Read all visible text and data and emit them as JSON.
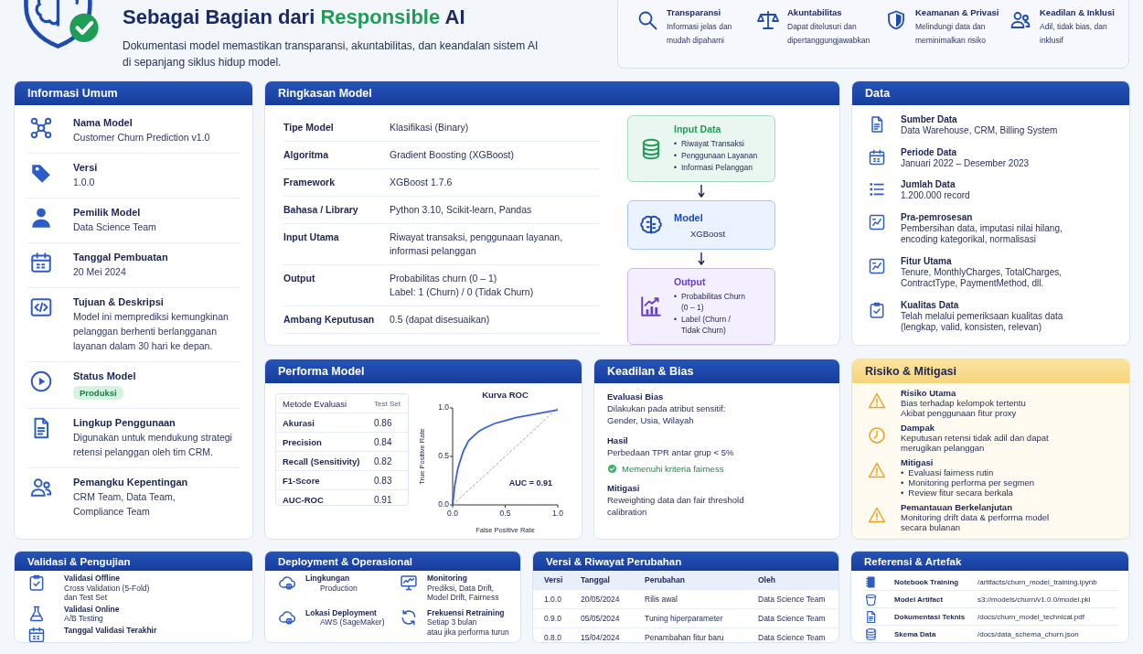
{
  "header": {
    "title": [
      {
        "text": "Sebagai Bagian dari ",
        "accent": false
      },
      {
        "text": "Responsible",
        "accent": true
      },
      {
        "text": " AI",
        "accent": false
      }
    ],
    "description": "Dokumentasi model memastikan transparansi, akuntabilitas, dan keandalan sistem AI\ndi sepanjang siklus hidup model.",
    "principles": [
      {
        "title": "Transparansi",
        "text": "Informasi jelas dan\nmudah dipahami"
      },
      {
        "title": "Akuntabilitas",
        "text": "Dapat ditelusuri dan\ndipertanggungjawabkan"
      },
      {
        "title": "Keamanan & Privasi",
        "text": "Melindungi data dan\nmeminimalkan risiko"
      },
      {
        "title": "Keadilan & Inklusi",
        "text": "Adil, tidak bias, dan\ninklusif"
      }
    ]
  },
  "general_info": {
    "title": "Informasi Umum",
    "items": [
      {
        "kind": "text",
        "label": "Nama Model",
        "value": "Customer Churn Prediction v1.0"
      },
      {
        "kind": "text",
        "label": "Versi",
        "value": "1.0.0"
      },
      {
        "kind": "text",
        "label": "Pemilik Model",
        "value": "Data Science Team"
      },
      {
        "kind": "text",
        "label": "Tanggal Pembuatan",
        "value": "20 Mei 2024"
      },
      {
        "kind": "text",
        "label": "Tujuan & Deskripsi",
        "value": "Model ini memprediksi kemungkinan\npelanggan berhenti berlangganan\nlayanan dalam 30 hari ke depan."
      },
      {
        "kind": "badge",
        "label": "Status Model",
        "value": "Produksi"
      },
      {
        "kind": "text",
        "label": "Lingkup Penggunaan",
        "value": "Digunakan untuk mendukung strategi\nretensi pelanggan oleh tim CRM."
      },
      {
        "kind": "text",
        "label": "Pemangku Kepentingan",
        "value": "CRM Team, Data Team,\nCompliance Team"
      }
    ]
  },
  "summary": {
    "title": "Ringkasan Model",
    "rows": [
      {
        "label": "Tipe Model",
        "value": "Klasifikasi (Binary)"
      },
      {
        "label": "Algoritma",
        "value": "Gradient Boosting (XGBoost)"
      },
      {
        "label": "Framework",
        "value": "XGBoost 1.7.6"
      },
      {
        "label": "Bahasa / Library",
        "value": "Python 3.10, Scikit-learn, Pandas"
      },
      {
        "label": "Input Utama",
        "value": "Riwayat transaksi, penggunaan layanan,\ninformasi pelanggan"
      },
      {
        "label": "Output",
        "value": "Probabilitas churn (0 – 1)\nLabel: 1 (Churn) / 0 (Tidak Churn)"
      },
      {
        "label": "Ambang Keputusan",
        "value": "0.5 (dapat disesuaikan)"
      }
    ],
    "flow": [
      {
        "kind": "input",
        "title": "Input Data",
        "marker": "•",
        "items": [
          "Riwayat Transaksi",
          "Penggunaan Layanan",
          "Informasi Pelanggan"
        ]
      },
      {
        "kind": "model",
        "title": "Model",
        "subtitle": "XGBoost"
      },
      {
        "kind": "output",
        "title": "Output",
        "marker": "•",
        "items": [
          "Probabilitas Churn\n(0 – 1)",
          "Label (Churn /\nTidak Churn)"
        ]
      }
    ]
  },
  "data": {
    "title": "Data",
    "items": [
      {
        "label": "Sumber Data",
        "value": "Data Warehouse, CRM, Billing System"
      },
      {
        "label": "Periode Data",
        "value": "Januari 2022 – Desember 2023"
      },
      {
        "label": "Jumlah Data",
        "value": "1.200.000 record"
      },
      {
        "label": "Pra-pemrosesan",
        "value": "Pembersihan data, imputasi nilai hilang,\nencoding kategorikal, normalisasi"
      },
      {
        "label": "Fitur Utama",
        "value": "Tenure, MonthlyCharges, TotalCharges,\nContractType, PaymentMethod, dll."
      },
      {
        "label": "Kualitas Data",
        "value": "Telah melalui pemeriksaan kualitas data\n(lengkap, valid, konsisten, relevan)"
      }
    ]
  },
  "performance": {
    "title": "Performa Model",
    "table": {
      "columns": [
        "Metode Evaluasi",
        "Test Set"
      ],
      "rows": [
        [
          "Akurasi",
          "0.86"
        ],
        [
          "Precision",
          "0.84"
        ],
        [
          "Recall (Sensitivity)",
          "0.82"
        ],
        [
          "F1-Score",
          "0.83"
        ],
        [
          "AUC-ROC",
          "0.91"
        ]
      ]
    },
    "chart_data": {
      "type": "line",
      "title": "Kurva ROC",
      "xlabel": "False Positive Rate",
      "ylabel": "True Positive Rate",
      "x": [
        0,
        0.02,
        0.05,
        0.1,
        0.15,
        0.2,
        0.25,
        0.3,
        0.4,
        0.5,
        0.6,
        0.8,
        1
      ],
      "series": [
        {
          "color": "#3a62d8",
          "values": [
            0,
            0.2,
            0.38,
            0.55,
            0.66,
            0.71,
            0.76,
            0.79,
            0.84,
            0.87,
            0.9,
            0.94,
            0.98
          ]
        },
        {
          "color": "#9aa3b5",
          "line_style": "dashed",
          "values": [
            0,
            0.02,
            0.05,
            0.1,
            0.15,
            0.2,
            0.25,
            0.3,
            0.4,
            0.5,
            0.6,
            0.8,
            1
          ]
        }
      ],
      "xlim": [
        0,
        1
      ],
      "ylim": [
        0,
        1
      ],
      "xticks": [
        {
          "value": 0,
          "label": "0.0"
        },
        {
          "value": 0.5,
          "label": "0.5"
        },
        {
          "value": 1,
          "label": "1.0"
        }
      ],
      "yticks": [
        {
          "value": 0,
          "label": "0.0"
        },
        {
          "value": 0.5,
          "label": "0.5"
        },
        {
          "value": 1,
          "label": "1.0"
        }
      ],
      "annotations": [
        "AUC = 0.91"
      ]
    }
  },
  "fairness": {
    "title": "Keadilan & Bias",
    "sections": [
      {
        "title": "Evaluasi Bias",
        "text": "Dilakukan pada atribut sensitif:\nGender, Usia, Wilayah"
      },
      {
        "title": "Hasil",
        "text": "Perbedaan TPR antar grup < 5%",
        "check": {
          "text": "Memenuhi kriteria fairness",
          "met": true
        }
      },
      {
        "title": "Mitigasi",
        "text": "Reweighting data dan fair threshold\ncalibration"
      }
    ]
  },
  "risks": {
    "title": "Risiko & Mitigasi",
    "items": [
      {
        "title": "Risiko Utama",
        "text": "Bias terhadap kelompok tertentu\nAkibat penggunaan fitur proxy"
      },
      {
        "title": "Dampak",
        "text": "Keputusan retensi tidak adil dan dapat\nmerugikan pelanggan"
      },
      {
        "title": "Mitigasi",
        "marker": "•",
        "bullets": [
          "Evaluasi fairness rutin",
          "Monitoring performa per segmen",
          "Review fitur secara berkala"
        ]
      },
      {
        "title": "Pemantauan Berkelanjutan",
        "text": "Monitoring drift data & performa model\nsecara bulanan"
      }
    ]
  },
  "validation": {
    "title": "Validasi & Pengujian",
    "items": [
      {
        "title": "Validasi Offline",
        "text": "Cross Validation (5-Fold)\ndan Test Set"
      },
      {
        "title": "Validasi Online",
        "text": "A/B Testing"
      },
      {
        "title": "Tanggal Validasi Terakhir"
      }
    ]
  },
  "deployment": {
    "title": "Deployment & Operasional",
    "items": [
      {
        "title": "Lingkungan",
        "text": "Production"
      },
      {
        "title": "Monitoring",
        "text": "Prediksi, Data Drift,\nModel Drift, Fairness"
      },
      {
        "title": "Lokasi Deployment",
        "text": "AWS (SageMaker)"
      },
      {
        "title": "Frekuensi Retraining",
        "text": "Setiap 3 bulan\natau jika performa turun"
      }
    ]
  },
  "versions": {
    "title": "Versi & Riwayat Perubahan",
    "columns": [
      "Versi",
      "Tanggal",
      "Perubahan",
      "Oleh"
    ],
    "rows": [
      [
        "1.0.0",
        "20/05/2024",
        "Rilis awal",
        "Data Science Team"
      ],
      [
        "0.9.0",
        "05/05/2024",
        "Tuning hiperparameter",
        "Data Science Team"
      ],
      [
        "0.8.0",
        "15/04/2024",
        "Penambahan fitur baru",
        "Data Science Team"
      ]
    ]
  },
  "references": {
    "title": "Referensi & Artefak",
    "items": [
      {
        "name": "Notebook Training",
        "path": "/artifacts/churn_model_training.ipynb"
      },
      {
        "name": "Model Artifact",
        "path": "s3://models/churn/v1.0.0/model.pkl"
      },
      {
        "name": "Dokumentasi Teknis",
        "path": "/docs/churn_model_technical.pdf"
      },
      {
        "name": "Skema Data",
        "path": "/docs/data_schema_churn.json"
      }
    ]
  }
}
